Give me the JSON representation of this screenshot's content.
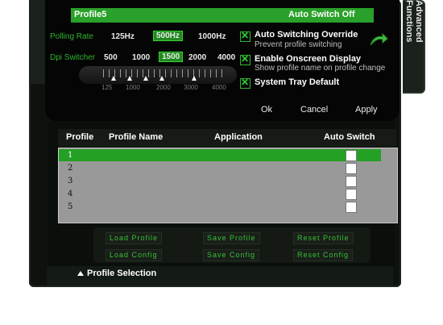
{
  "side_tab": {
    "label": "Advanced Functions"
  },
  "banner": {
    "profile_name": "Profile5",
    "auto_switch_status": "Auto Switch Off"
  },
  "polling": {
    "label": "Polling Rate",
    "options": [
      "125Hz",
      "500Hz",
      "1000Hz"
    ],
    "selected": "500Hz"
  },
  "dpi": {
    "label": "Dpi Switcher",
    "options": [
      "500",
      "1000",
      "1500",
      "2000",
      "4000"
    ],
    "selected": "1500",
    "scale_labels": [
      "125",
      "1000",
      "2000",
      "3000",
      "4000"
    ]
  },
  "options": {
    "auto_switch_override": {
      "title": "Auto Switching Override",
      "subtitle": "Prevent profile switching",
      "checked": true
    },
    "onscreen_display": {
      "title": "Enable Onscreen Display",
      "subtitle": "Show profile name on profile change",
      "checked": true
    },
    "system_tray": {
      "title": "System Tray Default",
      "checked": true
    }
  },
  "dialog": {
    "ok": "Ok",
    "cancel": "Cancel",
    "apply": "Apply"
  },
  "table": {
    "headers": {
      "profile": "Profile",
      "name": "Profile Name",
      "application": "Application",
      "auto_switch": "Auto Switch"
    },
    "rows": [
      "1",
      "2",
      "3",
      "4",
      "5"
    ],
    "selected_row": "1"
  },
  "actions": {
    "load_profile": "Load Profile",
    "save_profile": "Save Profile",
    "reset_profile": "Reset Profile",
    "load_config": "Load Config",
    "save_config": "Save Config",
    "reset_config": "Reset Config"
  },
  "footer": {
    "profile_selection": "Profile Selection"
  },
  "colors": {
    "accent": "#2aa12a",
    "background": "#0e120e",
    "list": "#999999"
  }
}
